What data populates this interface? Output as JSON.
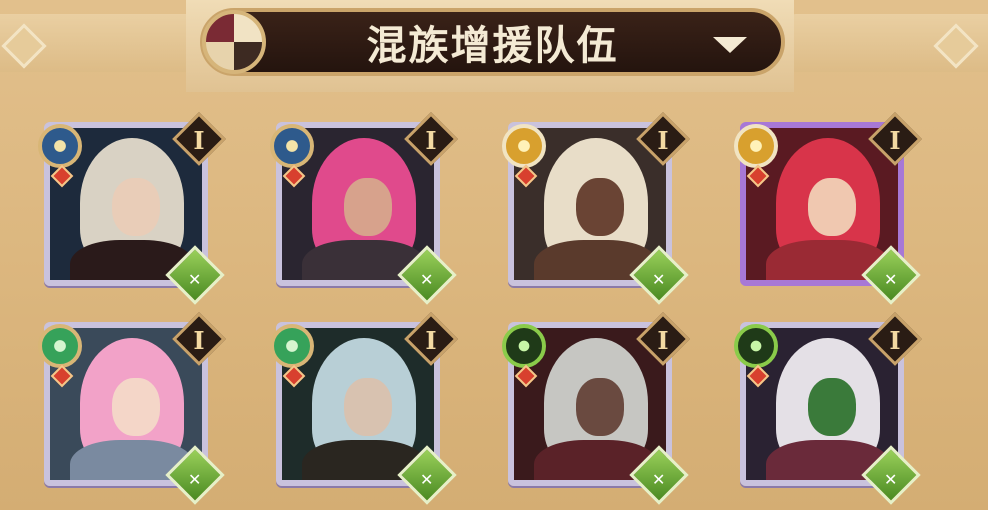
{
  "header": {
    "title": "混族增援队伍",
    "emblem_icon": "faction-emblem-icon",
    "dropdown_icon": "chevron-down-icon"
  },
  "heroes": [
    {
      "name": "hero-1",
      "rank": "I",
      "faction": "lightbearer",
      "class": "ranger",
      "frame": "standard",
      "colors": {
        "bg": "#1d2a3c",
        "hair": "#d9d2c4",
        "face": "#e9cdb8",
        "body": "#2a1a1a"
      }
    },
    {
      "name": "hero-2",
      "rank": "I",
      "faction": "lightbearer",
      "class": "ranger",
      "frame": "standard",
      "colors": {
        "bg": "#2a2530",
        "hair": "#e04a8c",
        "face": "#d7a28c",
        "body": "#3a3038"
      }
    },
    {
      "name": "hero-3",
      "rank": "I",
      "faction": "celestial",
      "class": "ranger",
      "frame": "standard",
      "colors": {
        "bg": "#3a2e2a",
        "hair": "#e8ddc8",
        "face": "#6a4434",
        "body": "#5a3a2c"
      }
    },
    {
      "name": "hero-4",
      "rank": "I",
      "faction": "celestial",
      "class": "ranger",
      "frame": "violet",
      "colors": {
        "bg": "#5a1a22",
        "hair": "#d8344a",
        "face": "#f0c8b0",
        "body": "#9a2a34"
      }
    },
    {
      "name": "hero-5",
      "rank": "I",
      "faction": "wilder",
      "class": "ranger",
      "frame": "standard",
      "colors": {
        "bg": "#3a4a5a",
        "hair": "#f2a2c8",
        "face": "#f4d6c8",
        "body": "#7a8aa0"
      }
    },
    {
      "name": "hero-6",
      "rank": "I",
      "faction": "wilder",
      "class": "ranger",
      "frame": "standard",
      "colors": {
        "bg": "#1e2c2a",
        "hair": "#b8cfd6",
        "face": "#d8c2b0",
        "body": "#2a2620"
      }
    },
    {
      "name": "hero-7",
      "rank": "I",
      "faction": "graveborn",
      "class": "ranger",
      "frame": "standard",
      "colors": {
        "bg": "#3a1a1c",
        "hair": "#c6c6c2",
        "face": "#6a4a40",
        "body": "#5a2228"
      }
    },
    {
      "name": "hero-8",
      "rank": "I",
      "faction": "graveborn",
      "class": "ranger",
      "frame": "standard",
      "colors": {
        "bg": "#2a2232",
        "hair": "#e4e0e6",
        "face": "#3a7a3a",
        "body": "#6a2a3a"
      }
    }
  ]
}
